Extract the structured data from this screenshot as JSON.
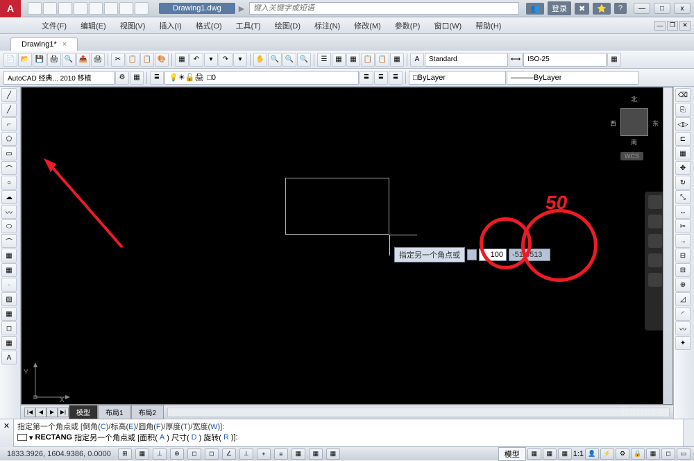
{
  "app": {
    "logo": "A"
  },
  "title": {
    "doc": "Drawing1.dwg",
    "search_placeholder": "键入关键字或短语",
    "login": "登录"
  },
  "win": {
    "min": "—",
    "max": "□",
    "close": "x"
  },
  "menu": {
    "file": "文件(F)",
    "edit": "编辑(E)",
    "view": "视图(V)",
    "insert": "插入(I)",
    "format": "格式(O)",
    "tools": "工具(T)",
    "draw": "绘图(D)",
    "annotate": "标注(N)",
    "modify": "修改(M)",
    "params": "参数(P)",
    "window": "窗口(W)",
    "help": "帮助(H)"
  },
  "tab": {
    "name": "Drawing1*",
    "close": "×"
  },
  "toolbar": {
    "style": "Standard",
    "dim": "ISO-25",
    "workspace": "AutoCAD 经典... 2010 移植",
    "layer": "0",
    "bylayer": "ByLayer",
    "bylayer2": "ByLayer"
  },
  "canvas": {
    "dyn_label": "指定另一个角点或",
    "dyn_x": "100",
    "dyn_y": "-51.8513",
    "annotation_50": "50",
    "ucs_x": "X",
    "ucs_y": "Y",
    "cube": {
      "n": "北",
      "s": "南",
      "e": "东",
      "w": "西",
      "wcs": "WCS"
    }
  },
  "layout": {
    "model": "模型",
    "layout1": "布局1",
    "layout2": "布局2",
    "nav_first": "|◀",
    "nav_prev": "◀",
    "nav_next": "▶",
    "nav_last": "▶|"
  },
  "cmd": {
    "line1_pre": "指定第一个角点或 [倒角(",
    "line1_c": "C",
    "line1_m1": ")/标高(",
    "line1_e": "E",
    "line1_m2": ")/圆角(",
    "line1_f": "F",
    "line1_m3": ")/厚度(",
    "line1_t": "T",
    "line1_m4": ")/宽度(",
    "line1_w": "W",
    "line1_end": ")]:",
    "line2_cmd": "RECTANG",
    "line2_pre": "指定另一个角点或 [面积(",
    "line2_a": "A",
    "line2_m1": ") 尺寸(",
    "line2_d": "D",
    "line2_m2": ") 旋转(",
    "line2_r": "R",
    "line2_end": ")]:",
    "close": "✕"
  },
  "status": {
    "coords": "1833.3926, 1604.9386, 0.0000",
    "model": "模型",
    "scale": "1:1"
  },
  "watermark": {
    "main": "Baidu 经验",
    "sub": "jingyan.baidu.com"
  }
}
